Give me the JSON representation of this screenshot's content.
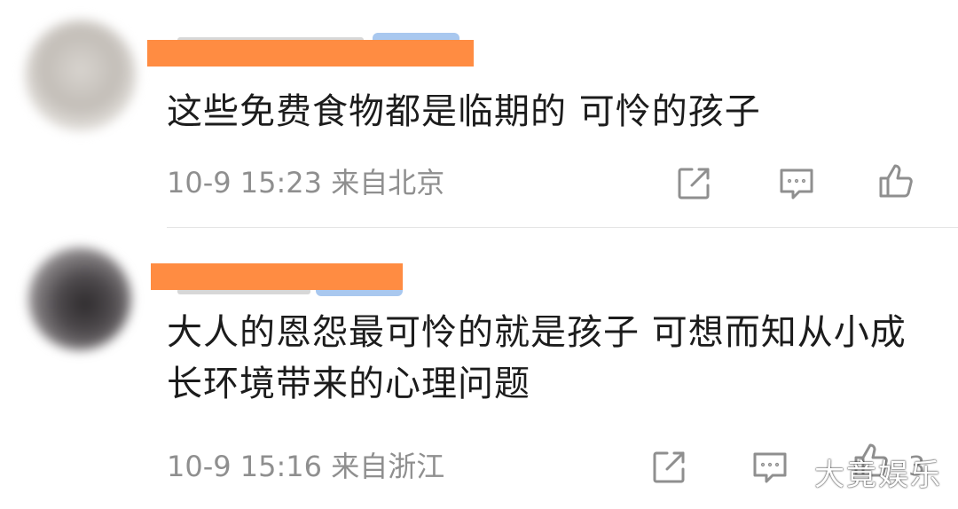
{
  "comments": [
    {
      "text": "这些免费食物都是临期的 可怜的孩子",
      "time": "10-9 15:23",
      "location": "来自北京",
      "likes": ""
    },
    {
      "text": "大人的恩怨最可怜的就是孩子 可想而知从小成长环境带来的心理问题",
      "time": "10-9 15:16",
      "location": "来自浙江",
      "likes": "3"
    }
  ],
  "icons": {
    "share": "share-icon",
    "reply": "comment-icon",
    "like": "thumbs-up-icon"
  },
  "colors": {
    "redaction": "#ff8c42",
    "meta_text": "#8f8f8f",
    "body_text": "#1c1c1c"
  },
  "watermark": "大竟娱乐"
}
